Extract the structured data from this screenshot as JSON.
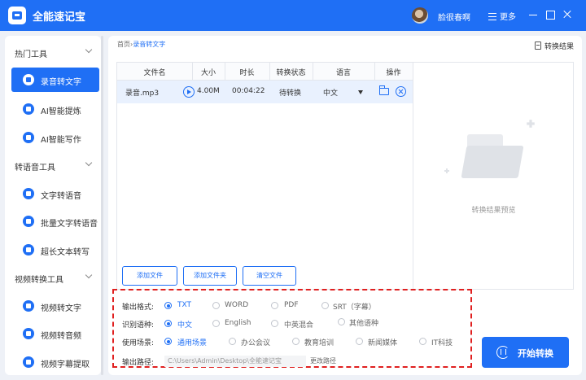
{
  "app": {
    "title": "全能速记宝"
  },
  "header": {
    "username": "脸很春啊",
    "more_label": "更多"
  },
  "sidebar": {
    "sections": [
      {
        "title": "热门工具",
        "items": [
          {
            "label": "录音转文字",
            "active": true
          },
          {
            "label": "AI智能提炼"
          },
          {
            "label": "AI智能写作"
          }
        ]
      },
      {
        "title": "转语音工具",
        "items": [
          {
            "label": "文字转语音"
          },
          {
            "label": "批量文字转语音"
          },
          {
            "label": "超长文本转写"
          }
        ]
      },
      {
        "title": "视频转换工具",
        "items": [
          {
            "label": "视频转文字"
          },
          {
            "label": "视频转音频"
          },
          {
            "label": "视频字幕提取"
          }
        ]
      }
    ]
  },
  "main": {
    "breadcrumb": {
      "home": "首页",
      "sep": "›",
      "current": "录音转文字"
    },
    "result_link": "转换结果",
    "table": {
      "columns": [
        "文件名",
        "大小",
        "时长",
        "转换状态",
        "语言",
        "操作"
      ],
      "rows": [
        {
          "name": "录音.mp3",
          "size": "4.00M",
          "duration": "00:04:22",
          "status": "待转换",
          "language": "中文"
        }
      ]
    },
    "buttons": {
      "add_file": "添加文件",
      "add_folder": "添加文件夹",
      "clear": "清空文件"
    },
    "preview_label": "转换结果预览"
  },
  "options": {
    "format": {
      "label": "输出格式:",
      "choices": [
        "TXT",
        "WORD",
        "PDF",
        "SRT（字幕）"
      ],
      "selected": "TXT"
    },
    "language": {
      "label": "识别语种:",
      "choices": [
        "中文",
        "English",
        "中英混合",
        "其他语种"
      ],
      "selected": "中文"
    },
    "scene": {
      "label": "使用场景:",
      "choices": [
        "通用场景",
        "办公会议",
        "教育培训",
        "新闻媒体",
        "IT科技"
      ],
      "selected": "通用场景"
    },
    "output": {
      "label": "输出路径:",
      "path": "C:\\Users\\Admin\\Desktop\\全能速记宝",
      "change_label": "更改路径"
    }
  },
  "start_button": "开始转换",
  "colors": {
    "accent": "#1f6ff5",
    "highlight_border": "#e02020"
  }
}
